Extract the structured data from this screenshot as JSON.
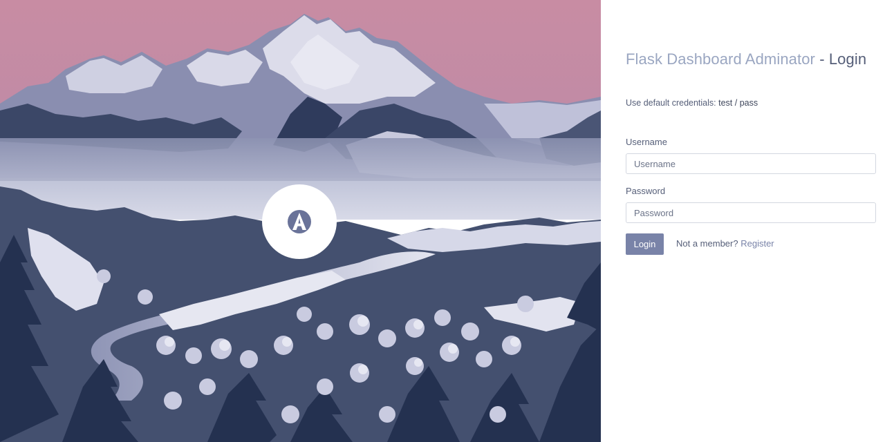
{
  "app": {
    "brand": "Flask Dashboard Adminator",
    "separator": "-",
    "page": "Login"
  },
  "hero": {
    "logo_icon": "adminator-logo-icon",
    "background": "winter-mountain-landscape"
  },
  "login": {
    "hint_prefix": "Use default credentials:",
    "hint_credentials": "test / pass",
    "username_label": "Username",
    "username_placeholder": "Username",
    "username_value": "",
    "password_label": "Password",
    "password_placeholder": "Password",
    "password_value": "",
    "submit_label": "Login",
    "member_prompt": "Not a member?",
    "register_label": "Register"
  },
  "colors": {
    "accent": "#7983a8",
    "brand_text": "#9aa6c1",
    "body_text": "#555e78",
    "sky": "#c38ba3",
    "dark_trees": "#283553"
  }
}
